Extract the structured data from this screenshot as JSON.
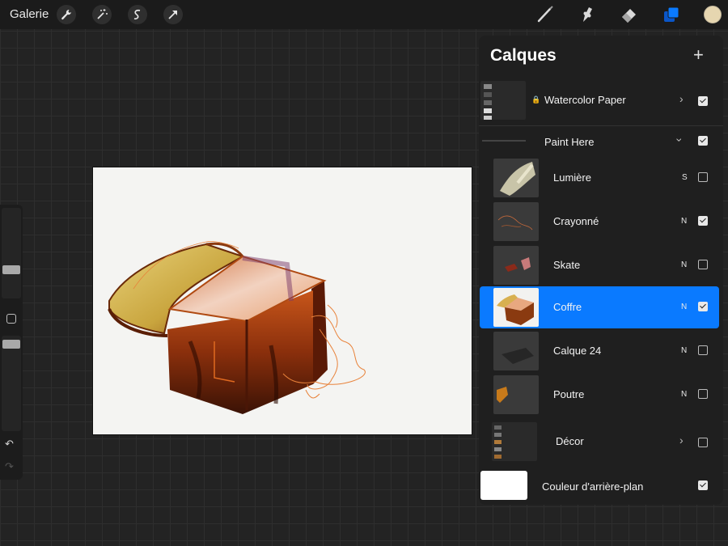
{
  "topbar": {
    "gallery_label": "Galerie",
    "left_tools": [
      "wrench-icon",
      "magic-wand-icon",
      "selection-icon",
      "transform-arrow-icon"
    ],
    "right_tools": [
      "brush-icon",
      "smudge-icon",
      "eraser-icon",
      "layers-icon"
    ],
    "current_color": "#e6d6b0",
    "layers_accent": "#0a7aff"
  },
  "sidebar": {
    "undo_icon": "↶",
    "redo_icon": "↷"
  },
  "layers": {
    "title": "Calques",
    "add_label": "+",
    "items": [
      {
        "name": "Watercolor Paper",
        "blend": "",
        "visible": true,
        "locked": true,
        "group": true,
        "expanded": false
      },
      {
        "name": "Paint Here",
        "blend": "",
        "visible": true,
        "group": true,
        "expanded": true
      },
      {
        "name": "Lumière",
        "blend": "S",
        "visible": false
      },
      {
        "name": "Crayonné",
        "blend": "N",
        "visible": true
      },
      {
        "name": "Skate",
        "blend": "N",
        "visible": false
      },
      {
        "name": "Coffre",
        "blend": "N",
        "visible": true,
        "selected": true
      },
      {
        "name": "Calque 24",
        "blend": "N",
        "visible": false
      },
      {
        "name": "Poutre",
        "blend": "N",
        "visible": false
      },
      {
        "name": "Décor",
        "blend": "",
        "visible": false,
        "group": true,
        "expanded": false
      },
      {
        "name": "Couleur d'arrière-plan",
        "blend": "",
        "visible": true
      }
    ]
  }
}
